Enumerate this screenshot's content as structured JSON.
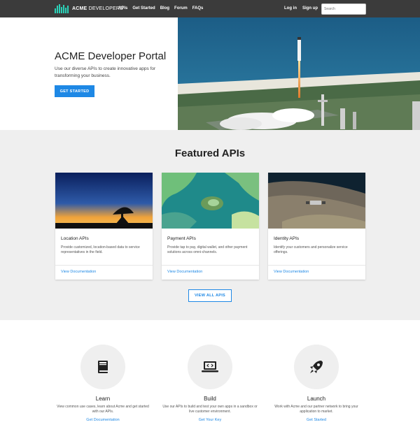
{
  "nav": {
    "brand_bold": "ACME",
    "brand_rest": " DEVELOPERS",
    "links": [
      "APIs",
      "Get Started",
      "Blog",
      "Forum",
      "FAQs"
    ],
    "login": "Log in",
    "signup": "Sign up",
    "search_placeholder": "Search",
    "bg_color": "#3b3b3b",
    "logo_color": "#2bd1b8"
  },
  "hero": {
    "title": "ACME Developer Portal",
    "description": "Use our diverse APIs to create innovative apps for transforming your business.",
    "cta": "GET STARTED",
    "image_icon": "rocket-launch-photo"
  },
  "featured": {
    "title": "Featured APIs",
    "cards": [
      {
        "title": "Location APIs",
        "description": "Provide customized, location-based data to service representatives in the field.",
        "link": "View Documentation",
        "image_icon": "radio-telescope-sunset-photo"
      },
      {
        "title": "Payment APIs",
        "description": "Provide tap to pay, digital wallet, and other payment solutions across omni-channels.",
        "link": "View Documentation",
        "image_icon": "ocean-satellite-photo"
      },
      {
        "title": "Identity APIs",
        "description": "Identify your customers and personalize service offerings.",
        "link": "View Documentation",
        "image_icon": "satellite-orbit-photo"
      }
    ],
    "view_all": "VIEW ALL APIS"
  },
  "features": [
    {
      "title": "Learn",
      "description": "View common use cases, learn about Acme and get started with our APIs.",
      "link": "Get Documentation",
      "icon": "book-icon"
    },
    {
      "title": "Build",
      "description": "Use our APIs to build and test your own apps in a sandbox or live customer environment.",
      "link": "Get Your Key",
      "icon": "laptop-code-icon"
    },
    {
      "title": "Launch",
      "description": "Work with Acme and our partner network to bring your application to market.",
      "link": "Get Started",
      "icon": "rocket-icon"
    }
  ],
  "colors": {
    "accent": "#1e88e5",
    "section_bg": "#efefef"
  }
}
